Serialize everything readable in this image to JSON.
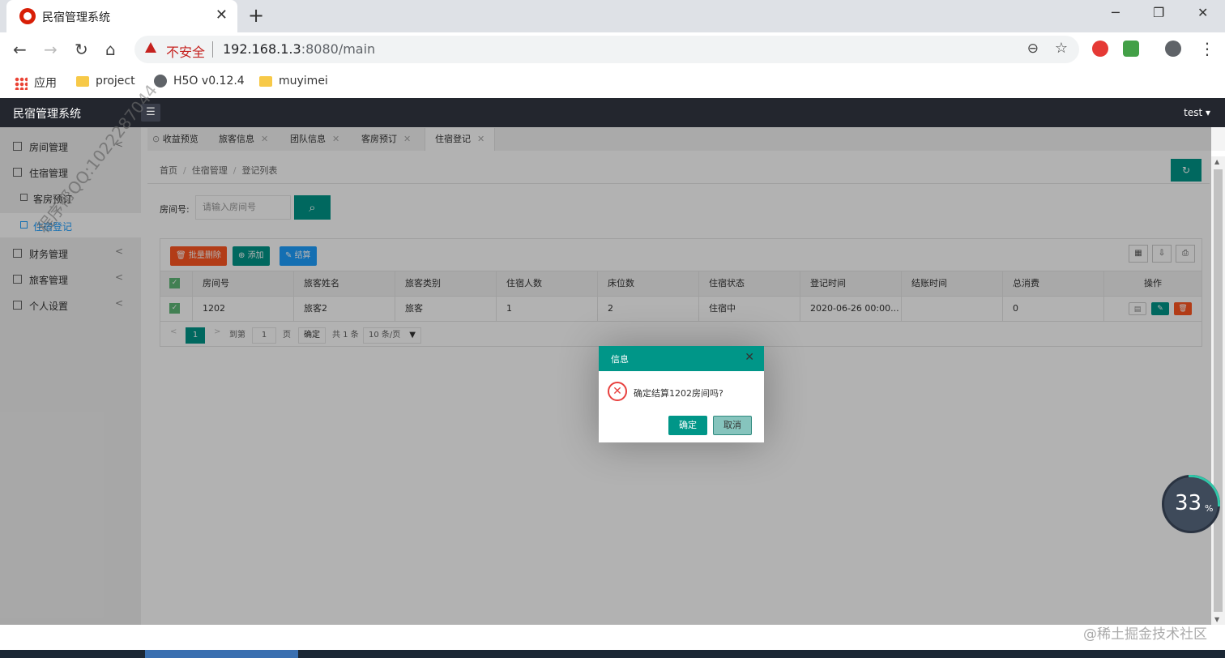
{
  "browser": {
    "tab_title": "民宿管理系统",
    "security_label": "不安全",
    "url_host": "192.168.1.3",
    "url_rest": ":8080/main",
    "bookmarks": [
      "应用",
      "project",
      "H5O v0.12.4",
      "muyimei"
    ]
  },
  "app": {
    "brand": "民宿管理系统",
    "user": "test"
  },
  "sidebar": {
    "items": [
      {
        "label": "房间管理",
        "icon": "grid-icon"
      },
      {
        "label": "住宿管理",
        "icon": "grid-icon"
      },
      {
        "label": "客房预订",
        "icon": "grid-icon"
      },
      {
        "label": "住宿登记",
        "icon": "grid-icon"
      },
      {
        "label": "财务管理",
        "icon": "grid-icon"
      },
      {
        "label": "旅客管理",
        "icon": "grid-icon"
      },
      {
        "label": "个人设置",
        "icon": "grid-icon"
      }
    ],
    "watermark": "程序帮QQ:1022287044"
  },
  "page_tabs": [
    "收益预览",
    "旅客信息",
    "团队信息",
    "客房预订",
    "住宿登记"
  ],
  "breadcrumb": [
    "首页",
    "住宿管理",
    "登记列表"
  ],
  "search": {
    "label": "房间号:",
    "placeholder": "请输入房间号"
  },
  "toolbar": {
    "batch_delete": "批量删除",
    "add": "添加",
    "checkout": "结算"
  },
  "table": {
    "headers": [
      "房间号",
      "旅客姓名",
      "旅客类别",
      "住宿人数",
      "床位数",
      "住宿状态",
      "登记时间",
      "结账时间",
      "总消费",
      "操作"
    ],
    "rows": [
      [
        "1202",
        "旅客2",
        "旅客",
        "1",
        "2",
        "住宿中",
        "2020-06-26 00:00...",
        "",
        "0"
      ]
    ]
  },
  "pager": {
    "current": "1",
    "goto_label": "到第",
    "goto_value": "1",
    "page_unit": "页",
    "ok": "确定",
    "total": "共 1 条",
    "per_page": "10 条/页"
  },
  "dialog": {
    "title": "信息",
    "message": "确定结算1202房间吗?",
    "ok": "确定",
    "cancel": "取消"
  },
  "progress": {
    "value": "33",
    "unit": "%"
  },
  "footer_watermark": "@稀土掘金技术社区",
  "colors": {
    "accent": "#009688",
    "danger": "#ff5722",
    "info": "#1e9fff",
    "topbar": "#23262e"
  }
}
